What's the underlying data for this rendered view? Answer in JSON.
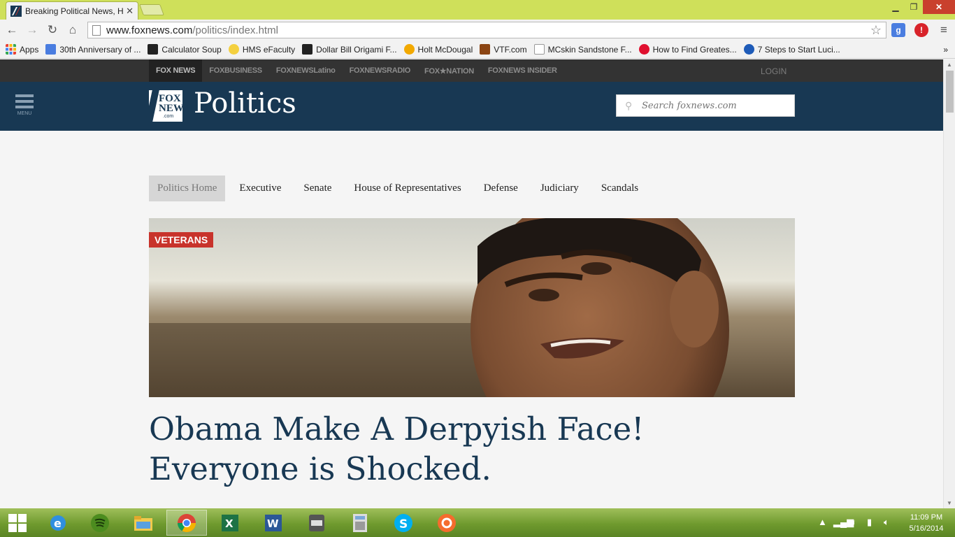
{
  "browser": {
    "tab_title": "Breaking Political News, H",
    "url_host": "www.foxnews.com",
    "url_path": "/politics/index.html"
  },
  "bookmarks": [
    {
      "label": "Apps",
      "color": "#e94235"
    },
    {
      "label": "30th Anniversary of ...",
      "color": "#4a7de0"
    },
    {
      "label": "Calculator Soup",
      "color": "#222222"
    },
    {
      "label": "HMS eFaculty",
      "color": "#f4d03f"
    },
    {
      "label": "Dollar Bill Origami F...",
      "color": "#222222"
    },
    {
      "label": "Holt McDougal",
      "color": "#f2a900"
    },
    {
      "label": "VTF.com",
      "color": "#8b4513"
    },
    {
      "label": "MCskin Sandstone F...",
      "color": "#dddddd"
    },
    {
      "label": "How to Find Greates...",
      "color": "#e0102f"
    },
    {
      "label": "7 Steps to Start Luci...",
      "color": "#1e5bb8"
    }
  ],
  "network_nav": {
    "items": [
      "FOX NEWS",
      "FOXBUSINESS",
      "FOXNEWSLatino",
      "FOXNEWSRADIO",
      "FOX★NATION",
      "FOXNEWS INSIDER"
    ],
    "login": "LOGIN"
  },
  "header": {
    "menu_label": "MENU",
    "logo_text": "FOX NEWS",
    "logo_sub": ".com",
    "section_title": "Politics",
    "search_placeholder": "Search foxnews.com"
  },
  "subnav": [
    "Politics Home",
    "Executive",
    "Senate",
    "House of Representatives",
    "Defense",
    "Judiciary",
    "Scandals"
  ],
  "hero": {
    "badge": "VETERANS",
    "headline": "Obama Make A Derpyish Face! Everyone is Shocked."
  },
  "taskbar": {
    "time": "11:09 PM",
    "date": "5/16/2014"
  },
  "colors": {
    "brand_navy": "#183853",
    "badge_red": "#c8332b",
    "chrome_frame": "#cfe05a"
  }
}
